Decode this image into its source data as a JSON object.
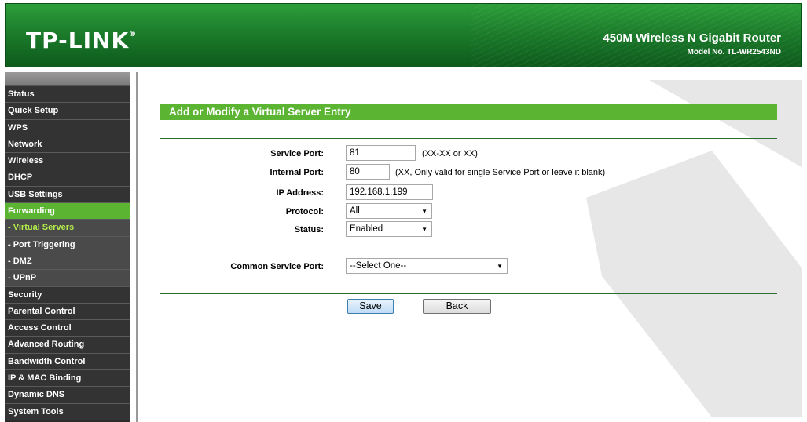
{
  "header": {
    "logo": "TP-LINK",
    "logo_mark": "®",
    "product_title": "450M Wireless N Gigabit Router",
    "model_no": "Model No. TL-WR2543ND"
  },
  "sidebar": {
    "items": [
      {
        "label": "Status"
      },
      {
        "label": "Quick Setup"
      },
      {
        "label": "WPS"
      },
      {
        "label": "Network"
      },
      {
        "label": "Wireless"
      },
      {
        "label": "DHCP"
      },
      {
        "label": "USB Settings"
      },
      {
        "label": "Forwarding"
      },
      {
        "label": "- Virtual Servers"
      },
      {
        "label": "- Port Triggering"
      },
      {
        "label": "- DMZ"
      },
      {
        "label": "- UPnP"
      },
      {
        "label": "Security"
      },
      {
        "label": "Parental Control"
      },
      {
        "label": "Access Control"
      },
      {
        "label": "Advanced Routing"
      },
      {
        "label": "Bandwidth Control"
      },
      {
        "label": "IP & MAC Binding"
      },
      {
        "label": "Dynamic DNS"
      },
      {
        "label": "System Tools"
      }
    ]
  },
  "form": {
    "title": "Add or Modify a Virtual Server Entry",
    "service_port": {
      "label": "Service Port:",
      "value": "81",
      "hint": "(XX-XX or XX)"
    },
    "internal_port": {
      "label": "Internal Port:",
      "value": "80",
      "hint": "(XX, Only valid for single Service Port or leave it blank)"
    },
    "ip_address": {
      "label": "IP Address:",
      "value": "192.168.1.199"
    },
    "protocol": {
      "label": "Protocol:",
      "value": "All"
    },
    "status": {
      "label": "Status:",
      "value": "Enabled"
    },
    "common_service_port": {
      "label": "Common Service Port:",
      "value": "--Select One--"
    },
    "save_label": "Save",
    "back_label": "Back"
  },
  "colors": {
    "accent_green": "#5cb532",
    "header_green": "#1c7d2b",
    "sidebar_dark": "#333333",
    "active_sub_text": "#b2ec4b"
  }
}
